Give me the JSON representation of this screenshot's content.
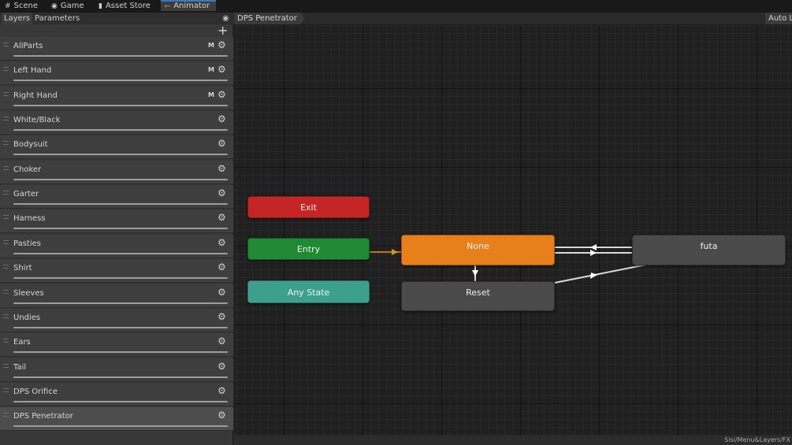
{
  "tabs": [
    {
      "label": "Scene",
      "icon": "grid-icon"
    },
    {
      "label": "Game",
      "icon": "gamepad-icon"
    },
    {
      "label": "Asset Store",
      "icon": "bag-icon"
    },
    {
      "label": "Animator",
      "icon": "animator-icon"
    }
  ],
  "active_tab": "Animator",
  "left_panel": {
    "subtabs": [
      "Layers",
      "Parameters"
    ],
    "active_subtab": "Layers",
    "add_button": "+",
    "layers": [
      {
        "name": "AllParts",
        "mask": "M"
      },
      {
        "name": "Left Hand",
        "mask": "M"
      },
      {
        "name": "Right Hand",
        "mask": "M"
      },
      {
        "name": "White/Black",
        "mask": ""
      },
      {
        "name": "Bodysuit",
        "mask": ""
      },
      {
        "name": "Choker",
        "mask": ""
      },
      {
        "name": "Garter",
        "mask": ""
      },
      {
        "name": "Harness",
        "mask": ""
      },
      {
        "name": "Pasties",
        "mask": ""
      },
      {
        "name": "Shirt",
        "mask": ""
      },
      {
        "name": "Sleeves",
        "mask": ""
      },
      {
        "name": "Undies",
        "mask": ""
      },
      {
        "name": "Ears",
        "mask": ""
      },
      {
        "name": "Tail",
        "mask": ""
      },
      {
        "name": "DPS Orifice",
        "mask": ""
      },
      {
        "name": "DPS Penetrator",
        "mask": ""
      }
    ],
    "selected_layer": "DPS Penetrator"
  },
  "graph": {
    "breadcrumb": "DPS Penetrator",
    "auto_live": "Auto Live Link",
    "footer_path": "Sisi/Menu&Layers/FX",
    "nodes": {
      "exit": "Exit",
      "entry": "Entry",
      "any_state": "Any State",
      "none": "None",
      "reset": "Reset",
      "futa": "futa"
    }
  },
  "colors": {
    "exit": "#c62525",
    "entry": "#1f8a33",
    "any_state": "#3da08d",
    "default_state": "#e7801b",
    "state": "#4a4a4a",
    "tab_accent": "#3a79bb"
  }
}
